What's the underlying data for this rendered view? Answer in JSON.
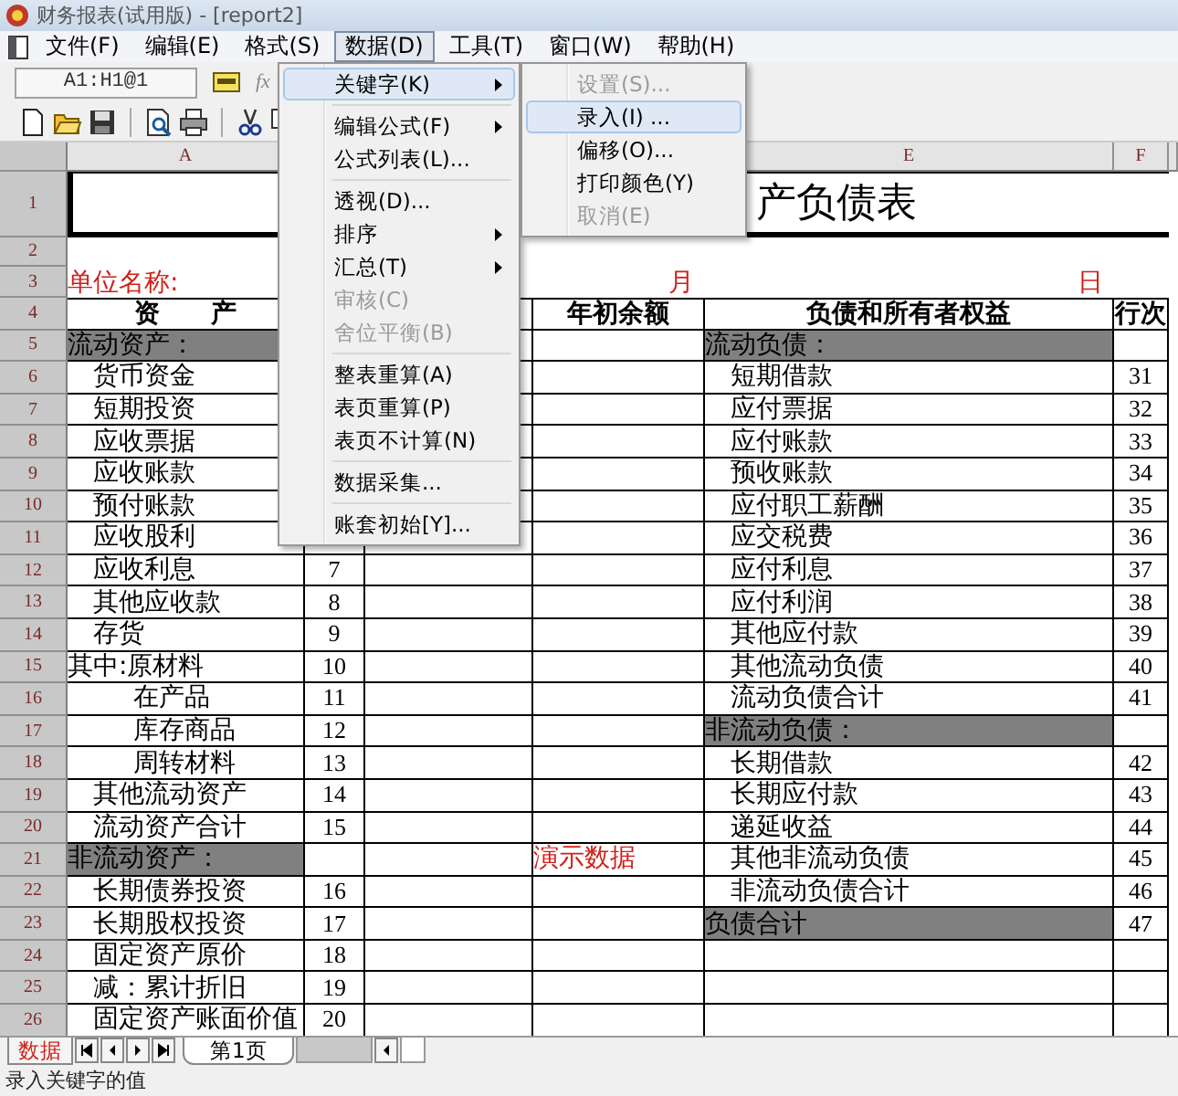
{
  "window": {
    "title": "财务报表(试用版) - [report2]"
  },
  "menu_bar": [
    {
      "label": "文件(F)",
      "selected": false
    },
    {
      "label": "编辑(E)",
      "selected": false
    },
    {
      "label": "格式(S)",
      "selected": false
    },
    {
      "label": "数据(D)",
      "selected": true
    },
    {
      "label": "工具(T)",
      "selected": false
    },
    {
      "label": "窗口(W)",
      "selected": false
    },
    {
      "label": "帮助(H)",
      "selected": false
    }
  ],
  "formula_bar": {
    "cell_ref": "A1:H1@1",
    "function_symbol": "fx"
  },
  "sheet": {
    "column_headers": {
      "a": "A",
      "e": "E",
      "f": "F"
    },
    "rows": [
      {
        "num": "1",
        "kind": "title",
        "cells": {
          "a": {
            "text": "产负债表",
            "kind": "title"
          }
        }
      },
      {
        "num": "2",
        "kind": "blank",
        "cells": {}
      },
      {
        "num": "3",
        "kind": "plain",
        "cells": {
          "a": {
            "text": "单位名称:",
            "kind": "label"
          },
          "d": {
            "text": "月",
            "kind": "label_right"
          },
          "e": {
            "text": "日",
            "kind": "label_right"
          }
        }
      },
      {
        "num": "4",
        "kind": "header",
        "cells": {
          "a": {
            "text": "资　　产",
            "kind": "heading"
          },
          "d": {
            "text": "年初余额",
            "kind": "heading"
          },
          "e": {
            "text": "负债和所有者权益",
            "kind": "heading"
          },
          "f": {
            "text": "行次",
            "kind": "heading"
          }
        }
      },
      {
        "num": "5",
        "kind": "body",
        "cells": {
          "a": {
            "text": "流动资产：",
            "kind": "section"
          },
          "e": {
            "text": "流动负债：",
            "kind": "section"
          }
        }
      },
      {
        "num": "6",
        "kind": "body",
        "cells": {
          "a": {
            "text": "货币资金",
            "kind": "item"
          },
          "e": {
            "text": "短期借款",
            "kind": "item"
          },
          "f": {
            "text": "31",
            "kind": "number"
          }
        }
      },
      {
        "num": "7",
        "kind": "body",
        "cells": {
          "a": {
            "text": "短期投资",
            "kind": "item"
          },
          "e": {
            "text": "应付票据",
            "kind": "item"
          },
          "f": {
            "text": "32",
            "kind": "number"
          }
        }
      },
      {
        "num": "8",
        "kind": "body",
        "cells": {
          "a": {
            "text": "应收票据",
            "kind": "item"
          },
          "e": {
            "text": "应付账款",
            "kind": "item"
          },
          "f": {
            "text": "33",
            "kind": "number"
          }
        }
      },
      {
        "num": "9",
        "kind": "body",
        "cells": {
          "a": {
            "text": "应收账款",
            "kind": "item"
          },
          "e": {
            "text": "预收账款",
            "kind": "item"
          },
          "f": {
            "text": "34",
            "kind": "number"
          }
        }
      },
      {
        "num": "10",
        "kind": "body",
        "cells": {
          "a": {
            "text": "预付账款",
            "kind": "item"
          },
          "e": {
            "text": "应付职工薪酬",
            "kind": "item"
          },
          "f": {
            "text": "35",
            "kind": "number"
          }
        }
      },
      {
        "num": "11",
        "kind": "body",
        "cells": {
          "a": {
            "text": "应收股利",
            "kind": "item"
          },
          "e": {
            "text": "应交税费",
            "kind": "item"
          },
          "f": {
            "text": "36",
            "kind": "number"
          }
        }
      },
      {
        "num": "12",
        "kind": "body",
        "cells": {
          "a": {
            "text": "应收利息",
            "kind": "item"
          },
          "b": {
            "text": "7",
            "kind": "number"
          },
          "e": {
            "text": "应付利息",
            "kind": "item"
          },
          "f": {
            "text": "37",
            "kind": "number"
          }
        }
      },
      {
        "num": "13",
        "kind": "body",
        "cells": {
          "a": {
            "text": "其他应收款",
            "kind": "item"
          },
          "b": {
            "text": "8",
            "kind": "number"
          },
          "e": {
            "text": "应付利润",
            "kind": "item"
          },
          "f": {
            "text": "38",
            "kind": "number"
          }
        }
      },
      {
        "num": "14",
        "kind": "body",
        "cells": {
          "a": {
            "text": "存货",
            "kind": "item"
          },
          "b": {
            "text": "9",
            "kind": "number"
          },
          "e": {
            "text": "其他应付款",
            "kind": "item"
          },
          "f": {
            "text": "39",
            "kind": "number"
          }
        }
      },
      {
        "num": "15",
        "kind": "body",
        "cells": {
          "a": {
            "text": "其中:原材料",
            "kind": "flush"
          },
          "b": {
            "text": "10",
            "kind": "number"
          },
          "e": {
            "text": "其他流动负债",
            "kind": "item"
          },
          "f": {
            "text": "40",
            "kind": "number"
          }
        }
      },
      {
        "num": "16",
        "kind": "body",
        "cells": {
          "a": {
            "text": "在产品",
            "kind": "sub"
          },
          "b": {
            "text": "11",
            "kind": "number"
          },
          "e": {
            "text": "流动负债合计",
            "kind": "item"
          },
          "f": {
            "text": "41",
            "kind": "number"
          }
        }
      },
      {
        "num": "17",
        "kind": "body",
        "cells": {
          "a": {
            "text": "库存商品",
            "kind": "sub"
          },
          "b": {
            "text": "12",
            "kind": "number"
          },
          "e": {
            "text": "非流动负债：",
            "kind": "section"
          }
        }
      },
      {
        "num": "18",
        "kind": "body",
        "cells": {
          "a": {
            "text": "周转材料",
            "kind": "sub"
          },
          "b": {
            "text": "13",
            "kind": "number"
          },
          "e": {
            "text": "长期借款",
            "kind": "item"
          },
          "f": {
            "text": "42",
            "kind": "number"
          }
        }
      },
      {
        "num": "19",
        "kind": "body",
        "cells": {
          "a": {
            "text": "其他流动资产",
            "kind": "item"
          },
          "b": {
            "text": "14",
            "kind": "number"
          },
          "e": {
            "text": "长期应付款",
            "kind": "item"
          },
          "f": {
            "text": "43",
            "kind": "number"
          }
        }
      },
      {
        "num": "20",
        "kind": "body",
        "cells": {
          "a": {
            "text": "流动资产合计",
            "kind": "item"
          },
          "b": {
            "text": "15",
            "kind": "number"
          },
          "e": {
            "text": "递延收益",
            "kind": "item"
          },
          "f": {
            "text": "44",
            "kind": "number"
          }
        }
      },
      {
        "num": "21",
        "kind": "body",
        "cells": {
          "a": {
            "text": "非流动资产：",
            "kind": "section"
          },
          "d": {
            "text": "演示数据",
            "kind": "note"
          },
          "e": {
            "text": "其他非流动负债",
            "kind": "item"
          },
          "f": {
            "text": "45",
            "kind": "number"
          }
        }
      },
      {
        "num": "22",
        "kind": "body",
        "cells": {
          "a": {
            "text": "长期债券投资",
            "kind": "item"
          },
          "b": {
            "text": "16",
            "kind": "number"
          },
          "e": {
            "text": "非流动负债合计",
            "kind": "item"
          },
          "f": {
            "text": "46",
            "kind": "number"
          }
        }
      },
      {
        "num": "23",
        "kind": "body",
        "cells": {
          "a": {
            "text": "长期股权投资",
            "kind": "item"
          },
          "b": {
            "text": "17",
            "kind": "number"
          },
          "e": {
            "text": "负债合计",
            "kind": "section"
          },
          "f": {
            "text": "47",
            "kind": "number"
          }
        }
      },
      {
        "num": "24",
        "kind": "body",
        "cells": {
          "a": {
            "text": "固定资产原价",
            "kind": "item"
          },
          "b": {
            "text": "18",
            "kind": "number"
          }
        }
      },
      {
        "num": "25",
        "kind": "body",
        "cells": {
          "a": {
            "text": "减：累计折旧",
            "kind": "item"
          },
          "b": {
            "text": "19",
            "kind": "number"
          }
        }
      },
      {
        "num": "26",
        "kind": "body",
        "cells": {
          "a": {
            "text": "固定资产账面价值",
            "kind": "item"
          },
          "b": {
            "text": "20",
            "kind": "number"
          }
        }
      }
    ]
  },
  "menu": {
    "items": [
      {
        "kind": "item",
        "label": "关键字(K)",
        "submenu": true,
        "selected": true,
        "disabled": false
      },
      {
        "kind": "separator"
      },
      {
        "kind": "item",
        "label": "编辑公式(F)",
        "submenu": true,
        "selected": false,
        "disabled": false
      },
      {
        "kind": "item",
        "label": "公式列表(L)...",
        "submenu": false,
        "selected": false,
        "disabled": false
      },
      {
        "kind": "separator"
      },
      {
        "kind": "item",
        "label": "透视(D)...",
        "submenu": false,
        "selected": false,
        "disabled": false
      },
      {
        "kind": "item",
        "label": "排序",
        "submenu": true,
        "selected": false,
        "disabled": false
      },
      {
        "kind": "item",
        "label": "汇总(T)",
        "submenu": true,
        "selected": false,
        "disabled": false
      },
      {
        "kind": "item",
        "label": "审核(C)",
        "submenu": false,
        "selected": false,
        "disabled": true
      },
      {
        "kind": "item",
        "label": "舍位平衡(B)",
        "submenu": false,
        "selected": false,
        "disabled": true
      },
      {
        "kind": "separator"
      },
      {
        "kind": "item",
        "label": "整表重算(A)",
        "submenu": false,
        "selected": false,
        "disabled": false
      },
      {
        "kind": "item",
        "label": "表页重算(P)",
        "submenu": false,
        "selected": false,
        "disabled": false
      },
      {
        "kind": "item",
        "label": "表页不计算(N)",
        "submenu": false,
        "selected": false,
        "disabled": false
      },
      {
        "kind": "separator"
      },
      {
        "kind": "item",
        "label": "数据采集...",
        "submenu": false,
        "selected": false,
        "disabled": false
      },
      {
        "kind": "separator"
      },
      {
        "kind": "item",
        "label": "账套初始[Y]...",
        "submenu": false,
        "selected": false,
        "disabled": false
      }
    ]
  },
  "submenu": {
    "items": [
      {
        "kind": "item",
        "label": "设置(S)...",
        "submenu": false,
        "selected": false,
        "disabled": true
      },
      {
        "kind": "item",
        "label": "录入(I) ...",
        "submenu": false,
        "selected": true,
        "disabled": false
      },
      {
        "kind": "item",
        "label": "偏移(O)...",
        "submenu": false,
        "selected": false,
        "disabled": false
      },
      {
        "kind": "item",
        "label": "打印颜色(Y)",
        "submenu": false,
        "selected": false,
        "disabled": false
      },
      {
        "kind": "item",
        "label": "取消(E)",
        "submenu": false,
        "selected": false,
        "disabled": true
      }
    ]
  },
  "sheet_tabs": [
    {
      "label": "数据",
      "kind": "mode"
    },
    {
      "label": "第1页",
      "kind": "page",
      "selected": true
    }
  ],
  "status_bar": "录入关键字的值"
}
